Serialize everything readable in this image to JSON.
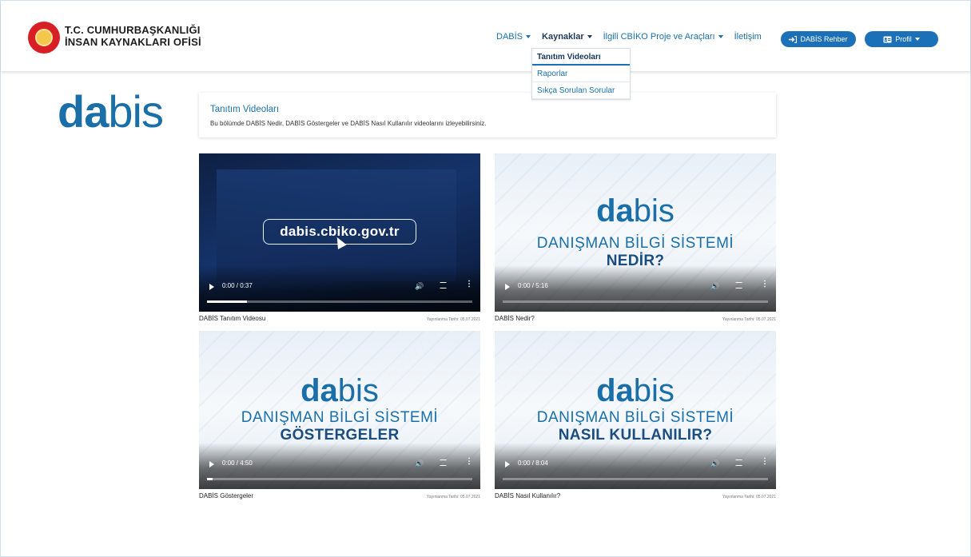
{
  "header": {
    "org_line1": "T.C. CUMHURBAŞKANLIĞI",
    "org_line2": "İNSAN KAYNAKLARI OFİSİ",
    "nav": [
      {
        "label": "DABİS",
        "active": false
      },
      {
        "label": "Kaynaklar",
        "active": true
      },
      {
        "label": "İlgili CBİKO Proje ve Araçları",
        "active": false
      },
      {
        "label": "İletişim",
        "active": false
      }
    ],
    "guide_button": "DABİS Rehber",
    "profile_button": "Profil"
  },
  "dropdown": {
    "items": [
      "Tanıtım Videoları",
      "Raporlar",
      "Sıkça Sorulan Sorular"
    ]
  },
  "brand": {
    "part1": "da",
    "part2": "bis"
  },
  "info": {
    "title": "Tanıtım Videoları",
    "description": "Bu bölümde DABİS Nedir, DABİS Göstergeler ve DABİS Nasıl Kullanılır videolarını izleyebilirsiniz."
  },
  "videos": [
    {
      "title": "DABİS Tanıtım Videosu",
      "date": "Yayınlanma Tarihi: 05.07.2021",
      "time": "0:00 / 0:37",
      "progress": 0.15,
      "url_text": "dabis.cbiko.gov.tr"
    },
    {
      "title": "DABİS Nedir?",
      "date": "Yayınlanma Tarihi: 05.07.2021",
      "time": "0:00 / 5:16",
      "progress": 0.0,
      "logo1": "da",
      "logo2": "bis",
      "sub": "DANIŞMAN BİLGİ SİSTEMİ",
      "sub2": "NEDİR?"
    },
    {
      "title": "DABİS Göstergeler",
      "date": "Yayınlanma Tarihi: 05.07.2021",
      "time": "0:00 / 4:50",
      "progress": 0.02,
      "logo1": "da",
      "logo2": "bis",
      "sub": "DANIŞMAN BİLGİ SİSTEMİ",
      "sub2": "GÖSTERGELER"
    },
    {
      "title": "DABİS Nasıl Kullanılır?",
      "date": "Yayınlanma Tarihi: 05.07.2021",
      "time": "0:00 / 8:04",
      "progress": 0.0,
      "logo1": "da",
      "logo2": "bis",
      "sub": "DANIŞMAN BİLGİ SİSTEMİ",
      "sub2": "NASIL KULLANILIR?"
    }
  ],
  "colors": {
    "accent": "#1b70b8",
    "brand": "#1a6fa8",
    "emblem": "#d81f26"
  }
}
